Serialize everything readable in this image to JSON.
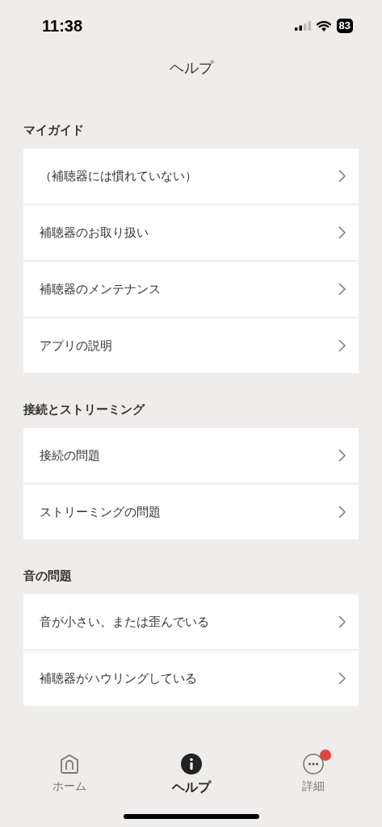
{
  "status_bar": {
    "time": "11:38",
    "battery": "83"
  },
  "title": "ヘルプ",
  "sections": [
    {
      "heading": "マイガイド",
      "items": [
        "（補聴器には慣れていない）",
        "補聴器のお取り扱い",
        "補聴器のメンテナンス",
        "アプリの説明"
      ]
    },
    {
      "heading": "接続とストリーミング",
      "items": [
        "接続の問題",
        "ストリーミングの問題"
      ]
    },
    {
      "heading": "音の問題",
      "items": [
        "音が小さい、または歪んでいる",
        "補聴器がハウリングしている"
      ]
    }
  ],
  "tabs": [
    {
      "kind": "home",
      "label": "ホーム",
      "selected": false,
      "badge": false
    },
    {
      "kind": "info",
      "label": "ヘルプ",
      "selected": true,
      "badge": false
    },
    {
      "kind": "more",
      "label": "詳細",
      "selected": false,
      "badge": true
    }
  ]
}
